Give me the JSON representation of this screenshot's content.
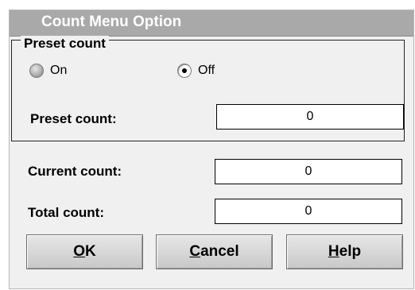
{
  "window": {
    "title": "Count Menu Option"
  },
  "preset_group": {
    "legend": "Preset count",
    "radio_on_label": "On",
    "radio_off_label": "Off",
    "selected": "Off",
    "field_label": "Preset count:",
    "field_value": "0"
  },
  "current_count": {
    "label": "Current count:",
    "value": "0"
  },
  "total_count": {
    "label": "Total count:",
    "value": "0"
  },
  "buttons": {
    "ok": {
      "mnemonic": "O",
      "rest": "K"
    },
    "cancel": {
      "mnemonic": "C",
      "rest": "ancel"
    },
    "help": {
      "mnemonic": "H",
      "rest": "elp"
    }
  },
  "colors": {
    "titlebar": "#a9a9a9",
    "dialog_bg": "#f0f0f0",
    "field_bg": "#ffffff"
  }
}
